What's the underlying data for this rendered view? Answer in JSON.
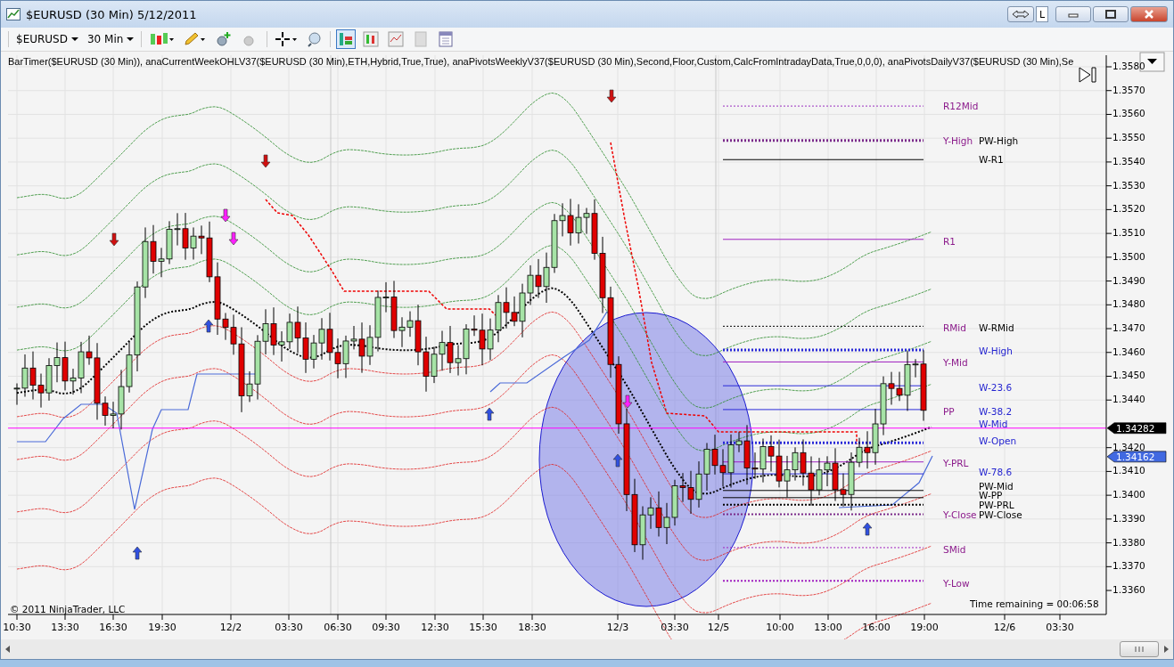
{
  "window": {
    "title": "$EURUSD (30 Min)  5/12/2011",
    "link_button": "L"
  },
  "toolbar": {
    "instrument": "$EURUSD",
    "interval": "30 Min"
  },
  "chart": {
    "indicators": "BarTimer($EURUSD (30 Min)), anaCurrentWeekOHLV37($EURUSD (30 Min),ETH,Hybrid,True,True), anaPivotsWeeklyV37($EURUSD (30 Min),Second,Floor,Custom,CalcFromIntradayData,True,0,0,0), anaPivotsDailyV37($EURUSD (30 Min),Se",
    "price_ticks": [
      "1.3580",
      "1.3570",
      "1.3560",
      "1.3550",
      "1.3540",
      "1.3530",
      "1.3520",
      "1.3510",
      "1.3500",
      "1.3490",
      "1.3480",
      "1.3470",
      "1.3460",
      "1.3450",
      "1.3440",
      "1.3420",
      "1.3410",
      "1.3400",
      "1.3390",
      "1.3380",
      "1.3370",
      "1.3360"
    ],
    "time_ticks": [
      "10:30",
      "13:30",
      "16:30",
      "19:30",
      "12/2",
      "03:30",
      "06:30",
      "09:30",
      "12:30",
      "15:30",
      "18:30",
      "12/3",
      "03:30",
      "12/5",
      "10:00",
      "13:00",
      "16:00",
      "19:00",
      "12/6",
      "03:30"
    ],
    "price_flags": [
      {
        "text": "1.34282",
        "color": "#000000"
      },
      {
        "text": "1.34162",
        "color": "#4169e1"
      }
    ],
    "pivot_labels": [
      {
        "text": "R12Mid",
        "color": "#8b1a8b"
      },
      {
        "text": "Y-High",
        "color": "#8b1a8b"
      },
      {
        "text": "PW-High",
        "color": "#000000"
      },
      {
        "text": "W-R1",
        "color": "#000000"
      },
      {
        "text": "R1",
        "color": "#8b1a8b"
      },
      {
        "text": "RMid",
        "color": "#8b1a8b"
      },
      {
        "text": "W-RMid",
        "color": "#000000"
      },
      {
        "text": "W-High",
        "color": "#2323d0"
      },
      {
        "text": "Y-Mid",
        "color": "#8b1a8b"
      },
      {
        "text": "W-23.6",
        "color": "#2323d0"
      },
      {
        "text": "PP",
        "color": "#8b1a8b"
      },
      {
        "text": "W-38.2",
        "color": "#2323d0"
      },
      {
        "text": "W-Mid",
        "color": "#2323d0"
      },
      {
        "text": "W-Open",
        "color": "#2323d0"
      },
      {
        "text": "Y-PRL",
        "color": "#8b1a8b"
      },
      {
        "text": "W-78.6",
        "color": "#2323d0"
      },
      {
        "text": "PW-Mid",
        "color": "#000000"
      },
      {
        "text": "W-PP",
        "color": "#000000"
      },
      {
        "text": "PW-PRL",
        "color": "#000000"
      },
      {
        "text": "Y-Close",
        "color": "#8b1a8b"
      },
      {
        "text": "PW-Close",
        "color": "#000000"
      },
      {
        "text": "SMid",
        "color": "#8b1a8b"
      },
      {
        "text": "Y-Low",
        "color": "#8b1a8b"
      }
    ],
    "copyright": "© 2011 NinjaTrader, LLC",
    "time_remaining": "Time remaining = 00:06:58"
  }
}
